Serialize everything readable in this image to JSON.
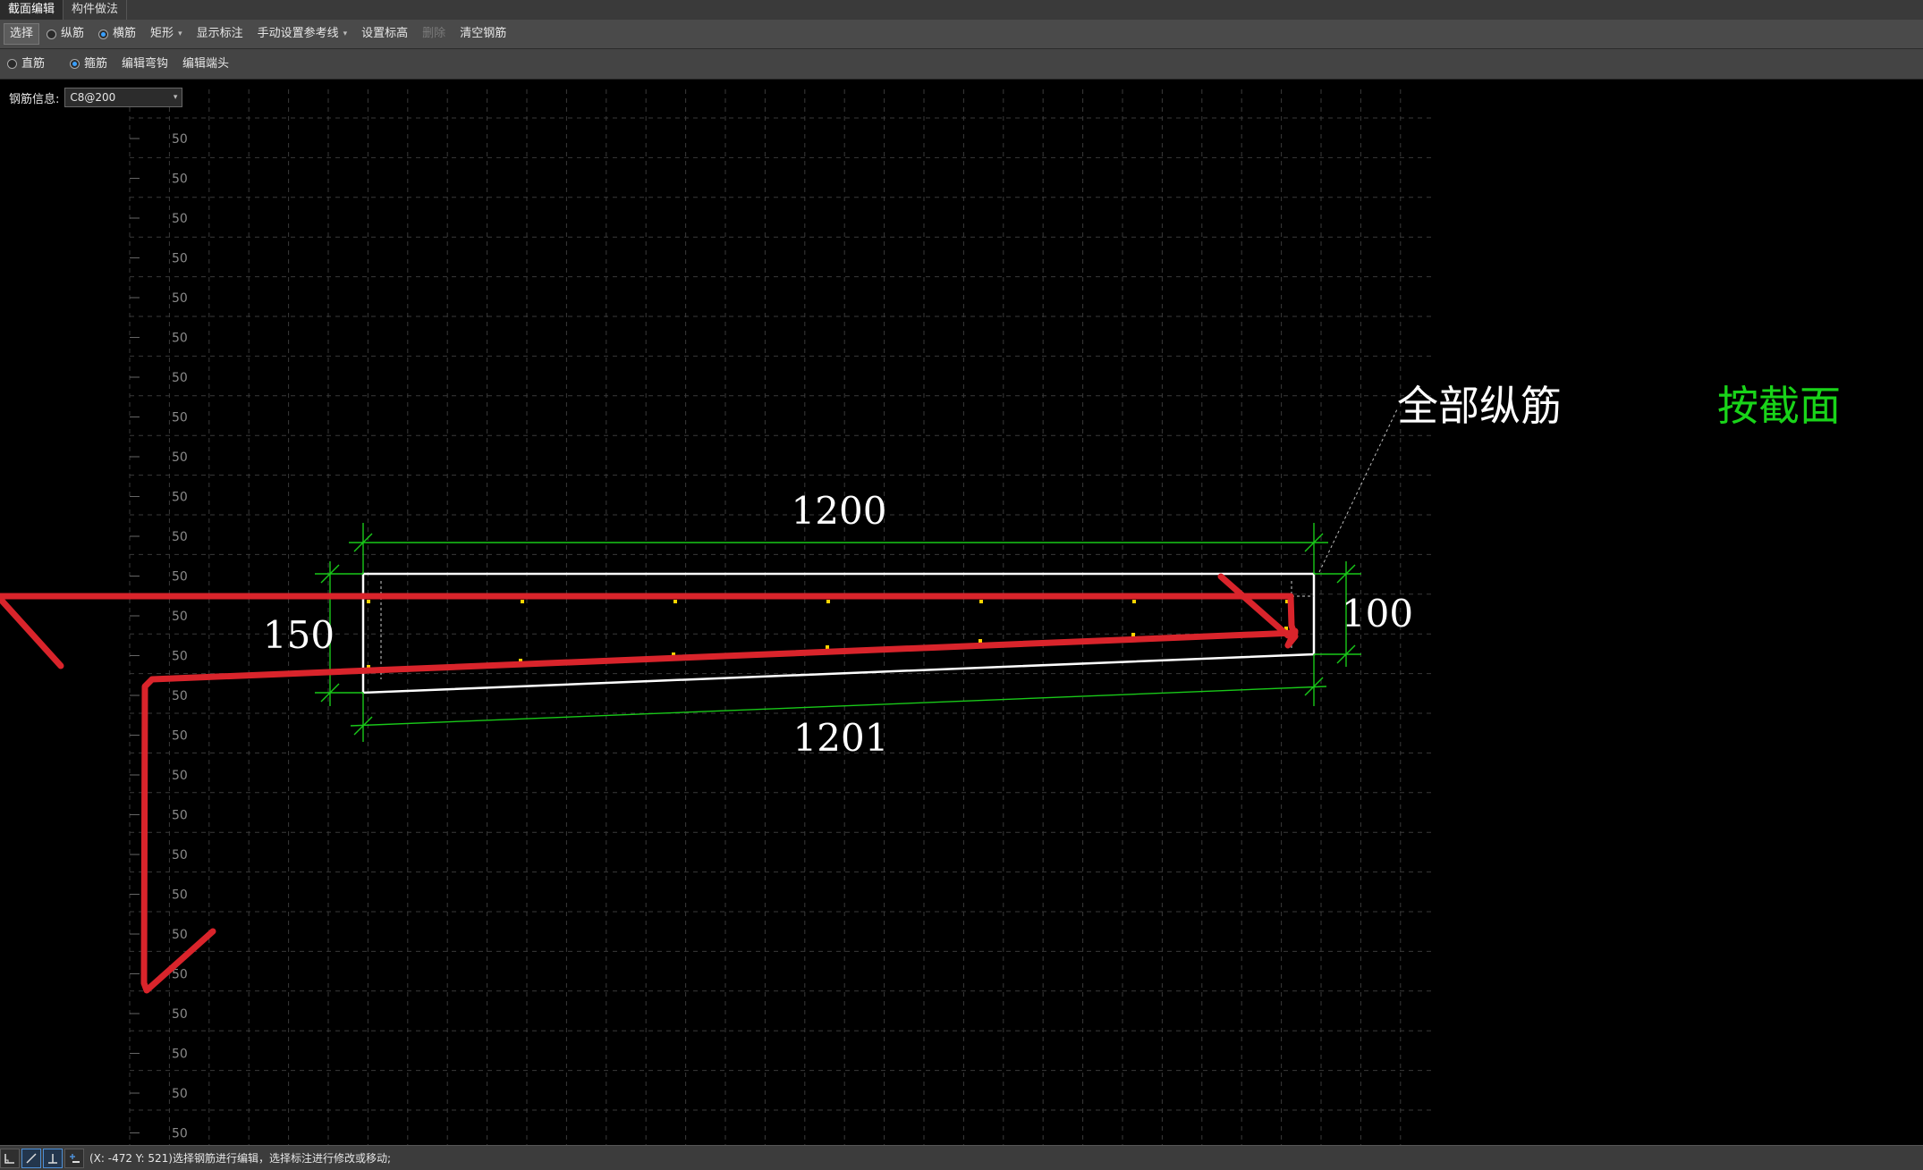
{
  "tabs": [
    {
      "label": "截面编辑",
      "active": true
    },
    {
      "label": "构件做法",
      "active": false
    }
  ],
  "toolbar1": {
    "select_label": "选择",
    "radio_longitudinal": "纵筋",
    "radio_transverse": "横筋",
    "rect_label": "矩形",
    "show_dims_label": "显示标注",
    "manual_ref_label": "手动设置参考线",
    "set_dims_label": "设置标高",
    "delete_label": "删除",
    "clear_rebar_label": "清空钢筋"
  },
  "toolbar2": {
    "radio_straight": "直筋",
    "radio_stirrup": "箍筋",
    "edit_hook_label": "编辑弯钩",
    "edit_end_label": "编辑端头"
  },
  "rebar_info": {
    "label": "钢筋信息:",
    "value": "C8@200"
  },
  "canvas": {
    "ruler_label": "50",
    "dim_top": "1200",
    "dim_bottom": "1201",
    "dim_left": "150",
    "dim_right": "100",
    "annotation_all_long": "全部纵筋",
    "annotation_section": "按截面"
  },
  "colors": {
    "dimension": "#19c919",
    "outline": "#ffffff",
    "markup": "#d9242b",
    "rebar_point": "#ffd400",
    "section_text": "#19d419"
  },
  "status": {
    "text": "(X: -472 Y: 521)选择钢筋进行编辑，选择标注进行修改或移动;"
  }
}
